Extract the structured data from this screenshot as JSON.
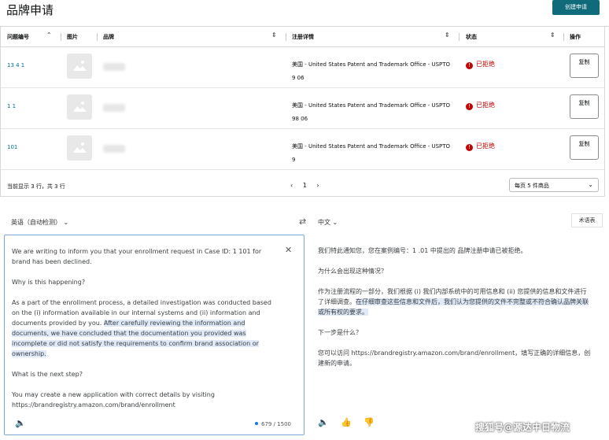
{
  "header": {
    "title": "品牌申请",
    "create_button": "创建申请"
  },
  "table": {
    "columns": [
      "问题编号",
      "图片",
      "品牌",
      "注册详情",
      "状态",
      "操作"
    ],
    "rows": [
      {
        "case_id": "13 4 1",
        "office": "美国 - United States Patent and Trademark Office - USPTO",
        "reg_no": "9 06",
        "status": "已拒绝",
        "action": "复制"
      },
      {
        "case_id": "1 1",
        "office": "美国 - United States Patent and Trademark Office - USPTO",
        "reg_no": "98 06",
        "status": "已拒绝",
        "action": "复制"
      },
      {
        "case_id": "101",
        "office": "美国 - United States Patent and Trademark Office - USPTO",
        "reg_no": "9",
        "status": "已拒绝",
        "action": "复制"
      }
    ],
    "footer": {
      "count_text": "当前显示 3 行，共 3 行",
      "prev": "‹",
      "page": "1",
      "next": "›",
      "per_page": "每页 5 件商品"
    }
  },
  "translator": {
    "source_lang": "英语（自动检测）",
    "target_lang": "中文",
    "glossary_button": "术语表",
    "source_paragraphs": {
      "p1": "We are writing to inform you that your enrollment request in Case ID: 1 101 for brand has been declined.",
      "p2": "Why is this happening?",
      "p3a": "As a part of the enrollment process, a detailed investigation was conducted based on the (i) information available in our internal systems and (ii) information and documents provided by you. ",
      "p3b": "After carefully reviewing the information and documents, we have concluded that the documentation you provided was incomplete or did not satisfy the requirements to confirm brand association or ownership.",
      "p4": "What is the next step?",
      "p5": "You may create a new application with correct details by visiting https://brandregistry.amazon.com/brand/enrollment"
    },
    "char_count": "679 / 1500",
    "target_paragraphs": {
      "p1": "我们特此通知您，您在案例编号：1 .01 中提出的 品牌注册申请已被拒绝。",
      "p2": "为什么会出现这种情况？",
      "p3a": "作为注册流程的一部分，我们根据 (i) 我们内部系统中的可用信息和 (ii) 您提供的信息和文件进行了详细调查。",
      "p3b": "在仔细审查这些信息和文件后，我们认为您提供的文件不完整或不符合确认品牌关联或所有权的要求。",
      "p4": "下一步是什么？",
      "p5": "您可以访问 https://brandregistry.amazon.com/brand/enrollment，填写正确的详细信息，创建新的申请。"
    },
    "watermark": "搜狐号@源达中日物流"
  },
  "colors": {
    "accent": "#0f6a7a",
    "link": "#007185",
    "danger": "#c40000",
    "highlight": "#dfe9f7"
  }
}
